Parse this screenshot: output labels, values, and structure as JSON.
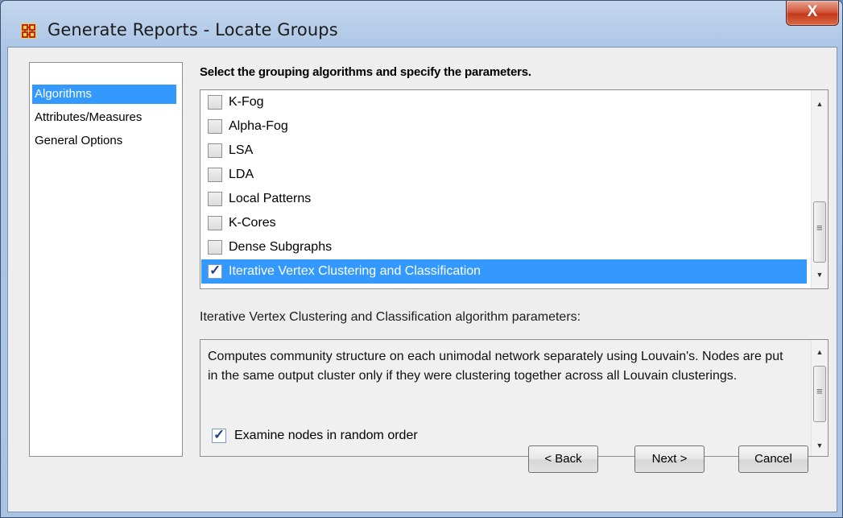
{
  "window": {
    "title": "Generate Reports - Locate Groups",
    "close_label": "X"
  },
  "sidebar": {
    "items": [
      {
        "label": "Algorithms",
        "selected": true
      },
      {
        "label": "Attributes/Measures",
        "selected": false
      },
      {
        "label": "General Options",
        "selected": false
      }
    ]
  },
  "main": {
    "heading": "Select the grouping algorithms and specify the parameters.",
    "algorithms": [
      {
        "label": "K-Fog",
        "checked": false,
        "selected": false
      },
      {
        "label": "Alpha-Fog",
        "checked": false,
        "selected": false
      },
      {
        "label": "LSA",
        "checked": false,
        "selected": false
      },
      {
        "label": "LDA",
        "checked": false,
        "selected": false
      },
      {
        "label": "Local Patterns",
        "checked": false,
        "selected": false
      },
      {
        "label": "K-Cores",
        "checked": false,
        "selected": false
      },
      {
        "label": "Dense Subgraphs",
        "checked": false,
        "selected": false
      },
      {
        "label": "Iterative Vertex Clustering and Classification",
        "checked": true,
        "selected": true
      }
    ],
    "params_label": "Iterative Vertex Clustering and Classification algorithm parameters:",
    "params": {
      "description": "Computes community structure on each unimodal network separately using Louvain's. Nodes are put in the same output cluster only if they were clustering together across all Louvain clusterings.",
      "option_label": "Examine nodes in random order",
      "option_checked": true
    }
  },
  "buttons": {
    "back": "< Back",
    "next": "Next >",
    "cancel": "Cancel"
  },
  "colors": {
    "selection": "#3399ff",
    "window_frame": "#a9c3e4",
    "close_button": "#c4391c"
  }
}
